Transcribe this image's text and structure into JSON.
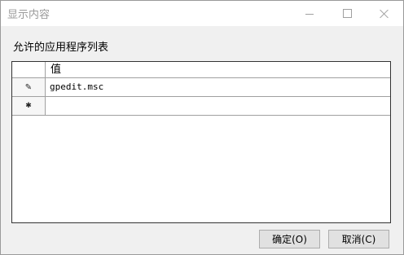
{
  "window": {
    "title": "显示内容"
  },
  "label": "允许的应用程序列表",
  "grid": {
    "column_header": "值",
    "rows": [
      {
        "indicator": "✎",
        "value": "gpedit.msc"
      },
      {
        "indicator": "✱",
        "value": ""
      }
    ]
  },
  "buttons": {
    "ok": "确定(O)",
    "cancel": "取消(C)"
  }
}
